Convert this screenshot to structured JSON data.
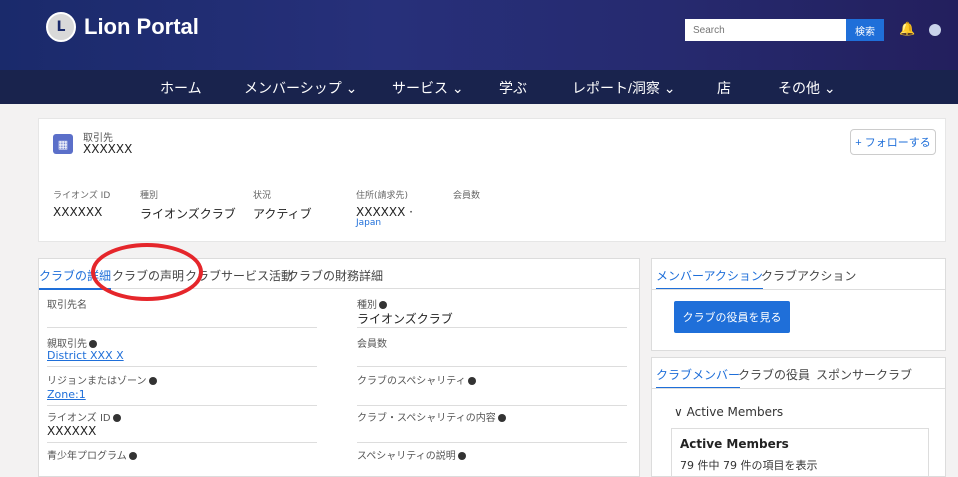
{
  "brand": {
    "title": "Lion Portal"
  },
  "search": {
    "placeholder": "Search",
    "button_label": "検索"
  },
  "nav": {
    "items": [
      "ホーム",
      "メンバーシップ ⌄",
      "サービス ⌄",
      "学ぶ",
      "レポート/洞察 ⌄",
      "店",
      "その他 ⌄"
    ]
  },
  "account": {
    "type_label": "取引先",
    "name": "XXXXXX",
    "follow_label": "+ フォローする"
  },
  "meta": [
    {
      "label": "ライオンズ ID",
      "value": "XXXXXX"
    },
    {
      "label": "種別",
      "value": "ライオンズクラブ"
    },
    {
      "label": "状況",
      "value": "アクティブ"
    },
    {
      "label": "住所(請求先)",
      "value": "XXXXXX ·",
      "sub": "Japan"
    },
    {
      "label": "会員数",
      "value": ""
    }
  ],
  "tabs": [
    "クラブの詳細",
    "クラブの声明",
    "クラブサービス活動",
    "クラブの財務詳細"
  ],
  "fields_left": [
    {
      "label": "取引先名",
      "value": ""
    },
    {
      "label": "親取引先",
      "link": "District XXX X"
    },
    {
      "label": "リジョンまたはゾーン",
      "link": "Zone:1"
    },
    {
      "label": "ライオンズ ID",
      "value": "XXXXXX"
    },
    {
      "label": "青少年プログラム",
      "value": ""
    }
  ],
  "fields_right": [
    {
      "label": "種別",
      "value": "ライオンズクラブ"
    },
    {
      "label": "会員数",
      "value": ""
    },
    {
      "label": "クラブのスペシャリティ",
      "value": ""
    },
    {
      "label": "クラブ・スペシャリティの内容",
      "value": ""
    },
    {
      "label": "スペシャリティの説明",
      "value": ""
    }
  ],
  "right_top": {
    "tabs": [
      "メンバーアクション",
      "クラブアクション"
    ],
    "button_label": "クラブの役員を見る"
  },
  "right_bottom": {
    "tabs": [
      "クラブメンバー",
      "クラブの役員",
      "スポンサークラブ"
    ],
    "accordion_label": "∨  Active Members",
    "box_title": "Active Members",
    "box_count": "79 件中 79 件の項目を表示"
  }
}
